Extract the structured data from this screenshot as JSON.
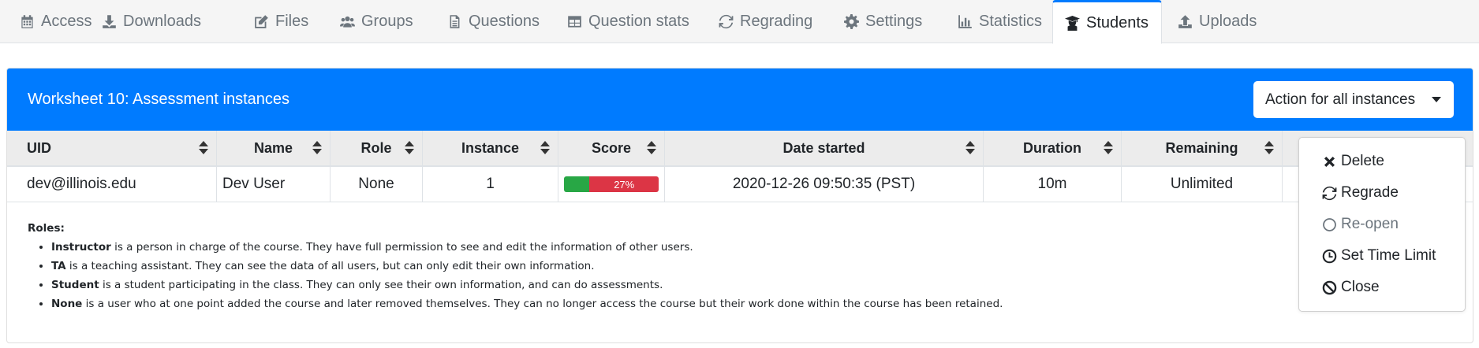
{
  "tabs": [
    {
      "label": "Access",
      "icon": "calendar-icon"
    },
    {
      "label": "Downloads",
      "icon": "download-icon"
    },
    {
      "label": "Files",
      "icon": "edit-icon"
    },
    {
      "label": "Groups",
      "icon": "users-icon"
    },
    {
      "label": "Questions",
      "icon": "file-icon"
    },
    {
      "label": "Question stats",
      "icon": "table-icon"
    },
    {
      "label": "Regrading",
      "icon": "sync-icon"
    },
    {
      "label": "Settings",
      "icon": "gear-icon"
    },
    {
      "label": "Statistics",
      "icon": "chart-icon"
    },
    {
      "label": "Students",
      "icon": "graduate-icon"
    },
    {
      "label": "Uploads",
      "icon": "upload-icon"
    }
  ],
  "active_tab": "Students",
  "card": {
    "title": "Worksheet 10: Assessment instances",
    "action_button": "Action for all instances"
  },
  "table": {
    "headers": [
      "UID",
      "Name",
      "Role",
      "Instance",
      "Score",
      "Date started",
      "Duration",
      "Remaining"
    ],
    "rows": [
      {
        "uid": "dev@illinois.edu",
        "name": "Dev User",
        "role": "None",
        "instance": "1",
        "score_label": "27%",
        "score_fraction": 0.27,
        "date_started": "2020-12-26 09:50:35 (PST)",
        "duration": "10m",
        "remaining": "Unlimited"
      }
    ]
  },
  "roles": {
    "heading": "Roles:",
    "items": [
      {
        "term": "Instructor",
        "text": " is a person in charge of the course. They have full permission to see and edit the information of other users."
      },
      {
        "term": "TA",
        "text": " is a teaching assistant. They can see the data of all users, but can only edit their own information."
      },
      {
        "term": "Student",
        "text": " is a student participating in the class. They can only see their own information, and can do assessments."
      },
      {
        "term": "None",
        "text": " is a user who at one point added the course and later removed themselves. They can no longer access the course but their work done within the course has been retained."
      }
    ]
  },
  "dropdown": {
    "items": [
      {
        "label": "Delete",
        "icon": "times-icon",
        "disabled": false
      },
      {
        "label": "Regrade",
        "icon": "sync-icon",
        "disabled": false
      },
      {
        "label": "Re-open",
        "icon": "circle-icon",
        "disabled": true
      },
      {
        "label": "Set Time Limit",
        "icon": "clock-icon",
        "disabled": false
      },
      {
        "label": "Close",
        "icon": "ban-icon",
        "disabled": false
      }
    ]
  },
  "colors": {
    "primary": "#007bff",
    "success": "#28a745",
    "danger": "#dc3545"
  }
}
